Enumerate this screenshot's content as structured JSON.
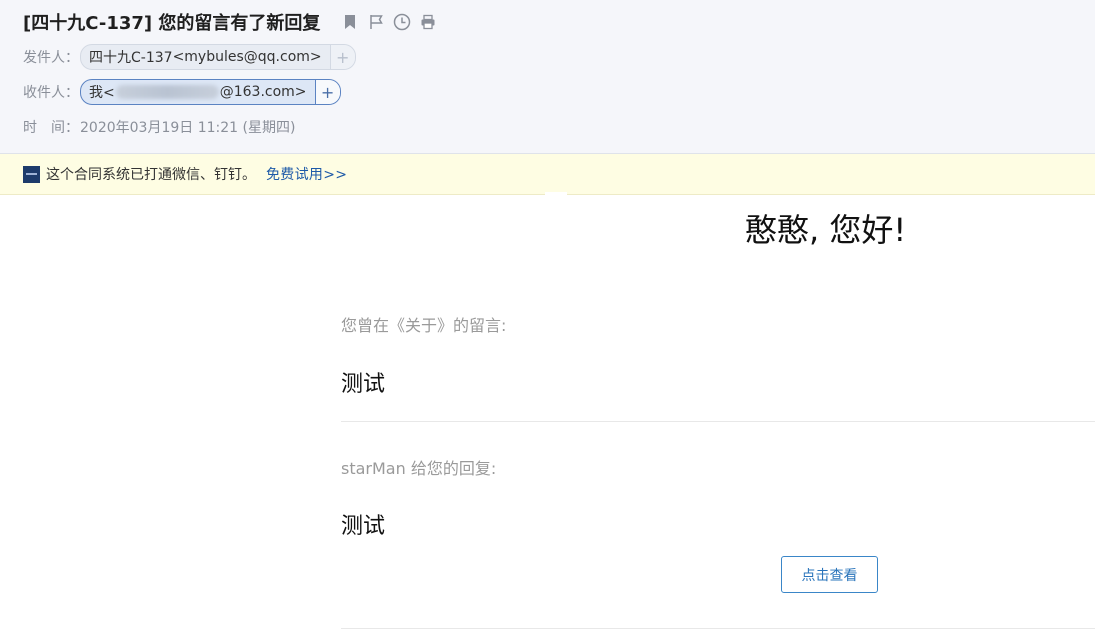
{
  "email": {
    "subject": "[四十九C-137] 您的留言有了新回复",
    "toolbar_icons": [
      "bookmark-icon",
      "flag-icon",
      "clock-icon",
      "print-icon"
    ],
    "from": {
      "label": "发件人：",
      "name": "四十九C-137",
      "address": "<mybules@qq.com>",
      "add_label": "+"
    },
    "to": {
      "label": "收件人：",
      "name_prefix": "我<",
      "address_suffix": "@163.com>",
      "add_label": "+"
    },
    "time": {
      "label": "时　间：",
      "value": "2020年03月19日 11:21 (星期四)"
    }
  },
  "notice": {
    "text": "这个合同系统已打通微信、钉钉。",
    "link": "免费试用>>"
  },
  "body": {
    "greeting": "憨憨, 您好!",
    "original_label": "您曾在《关于》的留言:",
    "original_content": "测试",
    "reply_label": "starMan 给您的回复:",
    "reply_content": "测试",
    "view_button": "点击查看"
  },
  "colors": {
    "header_bg": "#f5f6fa",
    "notice_bg": "#fefde3",
    "link": "#1e5aa8",
    "button_border": "#3a86c8"
  }
}
